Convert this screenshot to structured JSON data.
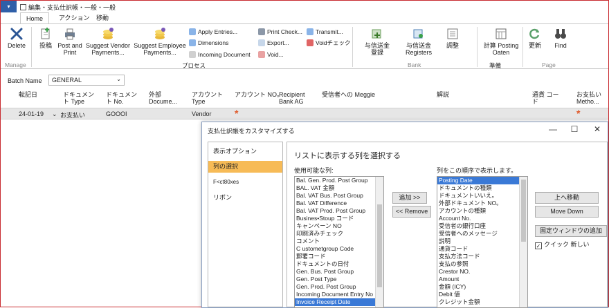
{
  "window": {
    "title": "編集・支払仕訳帳・一般・一般"
  },
  "tabs": [
    "Home",
    "アクション",
    "移動"
  ],
  "ribbon": {
    "delete": "Delete",
    "manage_group": "Manage",
    "post": "投稿",
    "post_print": "Post and Print",
    "suggest_vendor": "Suggest Vendor Payments...",
    "suggest_employee": "Suggest Employee Payments...",
    "apply_entries": "Apply Entries...",
    "dimensions": "Dimensions",
    "incoming_document": "Incoming Document",
    "print_check": "Print Check...",
    "export": "Export...",
    "void": "Void...",
    "transmit": "Transmit...",
    "void_check": "Voidチェック",
    "process_group": "プロセス",
    "payment_reg1": "与信送金登録",
    "payment_reg2": "与信送金 Registers",
    "reconcile": "調整",
    "bank_group": "Bank",
    "calculate": "計算 Posting Oaten",
    "prepare_group": "準備",
    "refresh": "更新",
    "find": "Find",
    "page_group": "Page"
  },
  "batch": {
    "label": "Batch Name",
    "value": "GENERAL"
  },
  "grid": {
    "headers": [
      "転記日",
      "ドキュメント Type",
      "ドキュメント No.",
      "外部 Docume...",
      "アカウント Type",
      "アカウント NO。",
      "Recipient Bank AG",
      "受信者への Meggie",
      "解説",
      "通貨 コード",
      "お支払い Metho..."
    ],
    "row": {
      "date": "24-01-19",
      "doc_type": "お支払い",
      "doc_no": "GOOOI",
      "account_type": "Vendor"
    }
  },
  "dialog": {
    "title": "支払仕訳帳をカスタマイズする",
    "nav": [
      "表示オプション",
      "列の選択",
      "F<ct80xes",
      "リボン"
    ],
    "heading": "リストに表示する列を選択する",
    "available_label": "使用可能な列:",
    "available": [
      "Bal. Gen. Prod. Post Group",
      "BAL. VAT 金額",
      "Bal. VAT Bus. Post Group",
      "Bal. VAT Difference",
      "Bal. VAT Prod. Post Group",
      "Busines•Stoup コード",
      "キャンペーン NO",
      "印刷済みチェック",
      "コメント",
      "C ustometgroup Code",
      "郵署コード",
      "ドキュメントの日付",
      "Gen. Bus. Post Group",
      "Gen. Post Type",
      "Gen. Prod. Post Group",
      "Incoming Document Entry No",
      "Invoice Receipt Date"
    ],
    "add_btn": "追加 >>",
    "remove_btn": "<< Remove",
    "order_label": "列をこの順序で表示します。",
    "shown": [
      "Posting Date",
      "ドキュメントの種類",
      "ドキュメントいいえ。",
      "外部ドキュメント NO。",
      "アカウントの種類",
      "Account No.",
      "受信者の銀行口座",
      "受信者へのメッセージ",
      "説明",
      "通貨コード",
      "支払方法コード",
      "支払の参照",
      "Crestor NO.",
      "Amount",
      "金額 (ICY)",
      "Debit 値",
      "クレジット金額"
    ],
    "move_up": "上へ移動",
    "move_down": "Move Down",
    "freeze": "固定ウィンドウの追加",
    "quick_label": "クイック 新しい"
  },
  "colors": {
    "accent": "#f7bb57",
    "selection": "#3a79d6",
    "title_blue": "#2f5fa8",
    "required": "#e05a2b"
  }
}
